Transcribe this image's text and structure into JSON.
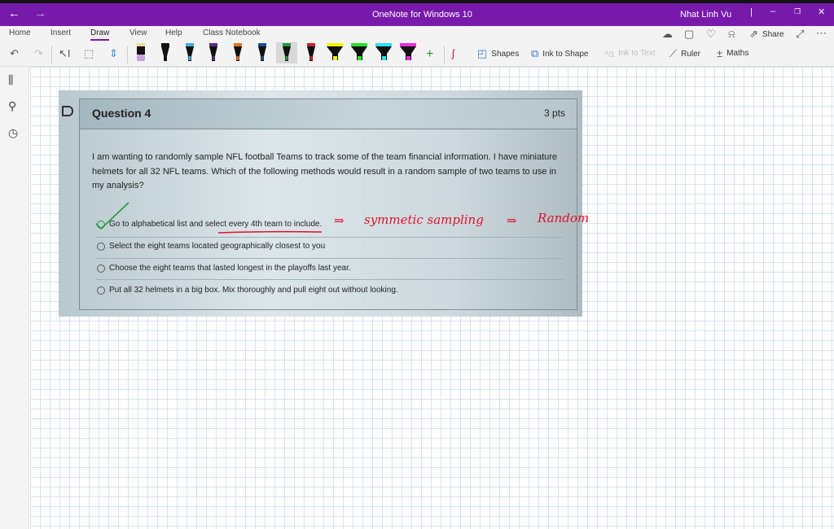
{
  "titlebar": {
    "app_title": "OneNote for Windows 10",
    "user": "Nhat Linh Vu",
    "back_icon": "arrow-left",
    "forward_icon": "arrow-right"
  },
  "tabs": [
    {
      "label": "Home"
    },
    {
      "label": "Insert"
    },
    {
      "label": "Draw",
      "active": true
    },
    {
      "label": "View"
    },
    {
      "label": "Help"
    },
    {
      "label": "Class Notebook"
    }
  ],
  "ribbon_right": {
    "share": "Share"
  },
  "tools": {
    "shapes": "Shapes",
    "ink_to_shape": "Ink to Shape",
    "ink_to_text": "Ink to Text",
    "ruler": "Ruler",
    "maths": "Maths"
  },
  "pens": [
    {
      "type": "eraser",
      "color": "#c9a0dc"
    },
    {
      "type": "pen",
      "color": "#111111"
    },
    {
      "type": "pen",
      "color": "#3ab0d8"
    },
    {
      "type": "pen",
      "color": "#5b2a86"
    },
    {
      "type": "pen",
      "color": "#e8731c"
    },
    {
      "type": "pen",
      "color": "#1f4e8c"
    },
    {
      "type": "pen",
      "color": "#1e9b3a",
      "selected": true
    },
    {
      "type": "pen",
      "color": "#d0202e"
    },
    {
      "type": "highlighter",
      "color": "#f5f500"
    },
    {
      "type": "highlighter",
      "color": "#28e028"
    },
    {
      "type": "highlighter",
      "color": "#28e0f0"
    },
    {
      "type": "highlighter",
      "color": "#f028e0"
    }
  ],
  "question": {
    "title": "Question 4",
    "points": "3 pts",
    "text": "I am wanting to randomly sample NFL football Teams to track some of the team financial information. I have miniature helmets for all 32 NFL teams. Which of the following methods would result in a random sample of two teams to use in my analysis?",
    "options": [
      {
        "label": "Go to alphabetical list and select every 4th team to include.",
        "selected": true
      },
      {
        "label": "Select the eight teams located geographically closest to you"
      },
      {
        "label": "Choose the eight teams that lasted longest in the playoffs last year."
      },
      {
        "label": "Put all 32 helmets in a big box. Mix thoroughly and pull eight out without looking."
      }
    ]
  },
  "annotations": {
    "arrow1": "⇒",
    "note1": "symmetic sampling",
    "arrow2": "⇒",
    "note2": "Random",
    "ink_color": "#e0102a",
    "check_color": "#1e9b3a"
  }
}
